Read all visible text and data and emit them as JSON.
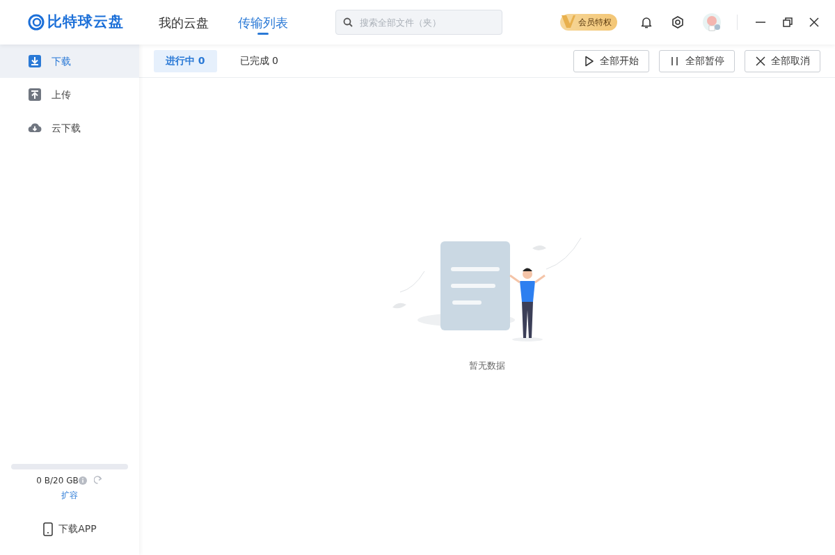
{
  "app": {
    "logo_text": "比特球云盘"
  },
  "nav_tabs": [
    {
      "label": "我的云盘",
      "selected": false
    },
    {
      "label": "传输列表",
      "selected": true
    }
  ],
  "search": {
    "placeholder": "搜索全部文件（夹）"
  },
  "vip_badge": {
    "label": "会员特权"
  },
  "sidebar": {
    "items": [
      {
        "label": "下载",
        "kind": "download",
        "selected": true
      },
      {
        "label": "上传",
        "kind": "upload",
        "selected": false
      },
      {
        "label": "云下载",
        "kind": "cloud",
        "selected": false
      }
    ],
    "storage": {
      "level": 0,
      "usage": "0 B/20 GB",
      "expand_link": "扩容"
    },
    "download_app": "下载APP"
  },
  "sub_tabs": [
    {
      "label": "进行中 0",
      "selected": true
    },
    {
      "label": "已完成 0",
      "selected": false
    }
  ],
  "actions": [
    {
      "label": "全部开始",
      "kind": "play"
    },
    {
      "label": "全部暂停",
      "kind": "pause"
    },
    {
      "label": "全部取消",
      "kind": "cancel"
    }
  ],
  "empty_state": {
    "message": "暂无数据"
  }
}
